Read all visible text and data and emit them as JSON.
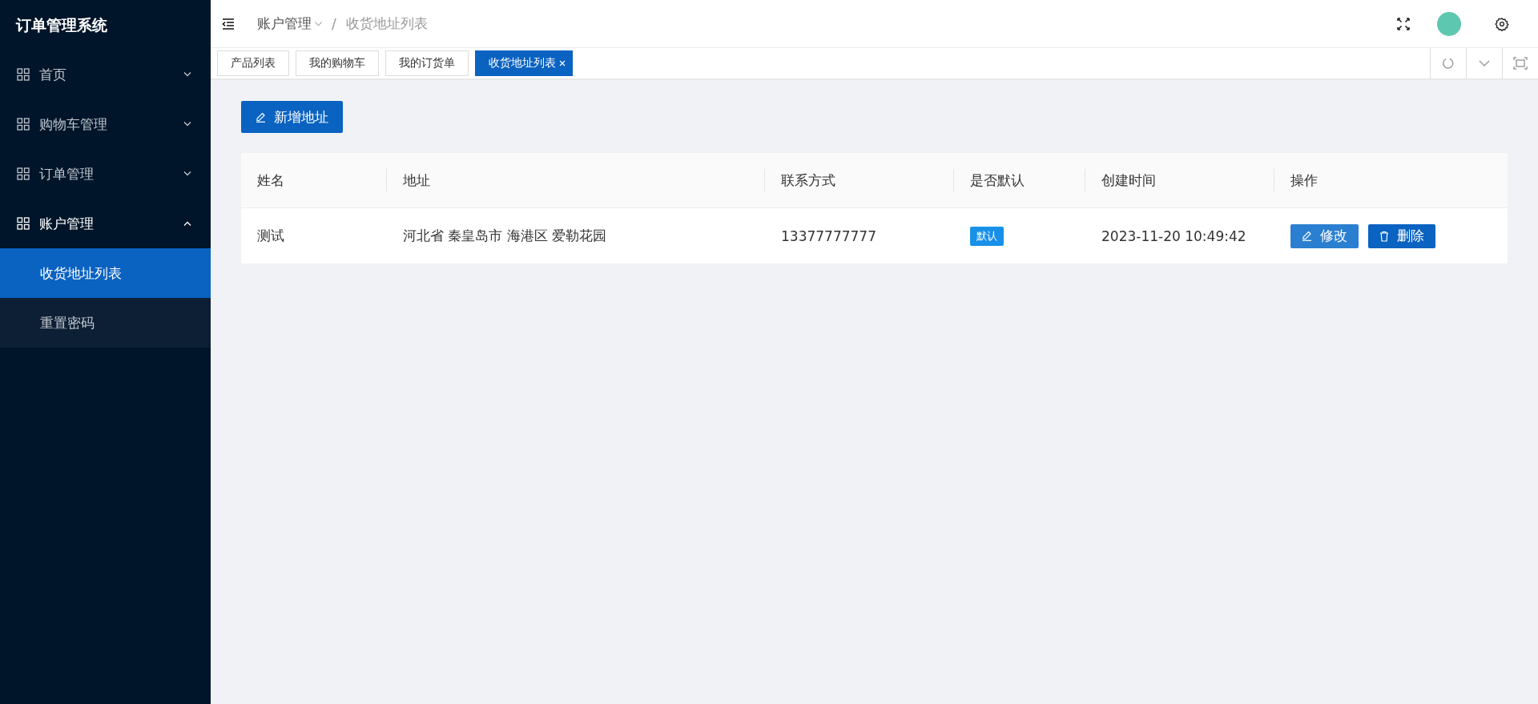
{
  "app_title": "订单管理系统",
  "sidebar": {
    "items": [
      {
        "label": "首页",
        "expanded": false
      },
      {
        "label": "购物车管理",
        "expanded": false
      },
      {
        "label": "订单管理",
        "expanded": false
      },
      {
        "label": "账户管理",
        "expanded": true,
        "children": [
          {
            "label": "收货地址列表",
            "selected": true
          },
          {
            "label": "重置密码",
            "selected": false
          }
        ]
      }
    ]
  },
  "breadcrumb": [
    "账户管理",
    "/",
    "收货地址列表"
  ],
  "tabs": [
    {
      "label": "产品列表",
      "selected": false
    },
    {
      "label": "我的购物车",
      "selected": false
    },
    {
      "label": "我的订货单",
      "selected": false
    },
    {
      "label": "收货地址列表",
      "selected": true
    }
  ],
  "add_button": "新增地址",
  "table": {
    "columns": [
      "姓名",
      "地址",
      "联系方式",
      "是否默认",
      "创建时间",
      "操作"
    ],
    "rows": [
      {
        "name": "测试",
        "address": "河北省 秦皇岛市 海港区 爱勒花园",
        "phone": "13377777777",
        "default_tag": "默认",
        "created": "2023-11-20 10:49:42",
        "actions": [
          {
            "kind": "edit",
            "label": "修改"
          },
          {
            "kind": "delete",
            "label": "删除"
          }
        ]
      }
    ]
  }
}
